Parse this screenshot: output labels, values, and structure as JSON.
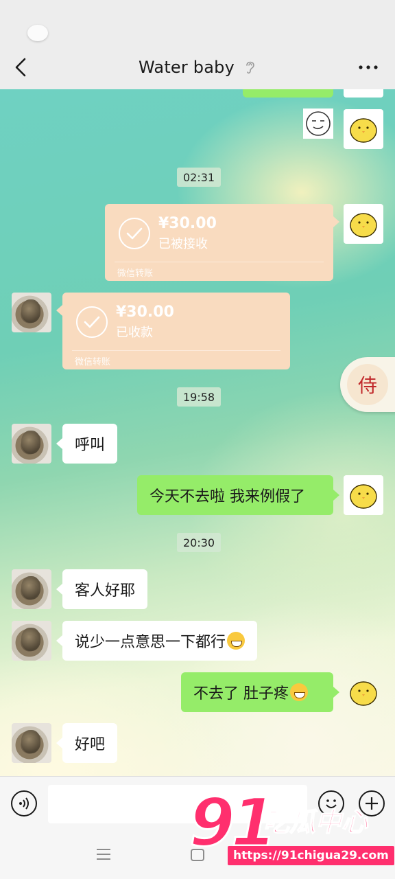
{
  "header": {
    "title": "Water baby"
  },
  "messages": {
    "time_1": "02:31",
    "transfer_sent": {
      "amount": "¥30.00",
      "status": "已被接收",
      "footer": "微信转账"
    },
    "transfer_received": {
      "amount": "¥30.00",
      "status": "已收款",
      "footer": "微信转账"
    },
    "time_2": "19:58",
    "msg_call": "呼叫",
    "msg_not_going": "今天不去啦 我来例假了",
    "time_3": "20:30",
    "msg_guest": "客人好耶",
    "msg_less": "说少一点意思一下都行",
    "msg_stomach": "不去了 肚子疼",
    "msg_ok": "好吧"
  },
  "floating_badge": {
    "glyph": "侍"
  },
  "input": {
    "value": ""
  },
  "watermark": {
    "number": "91",
    "brand": "吃瓜中心",
    "url": "https://91chigua29.com"
  },
  "colors": {
    "green_bubble": "#95ec69",
    "transfer_bubble": "#f9dbbf",
    "watermark": "#ff2f6e"
  }
}
